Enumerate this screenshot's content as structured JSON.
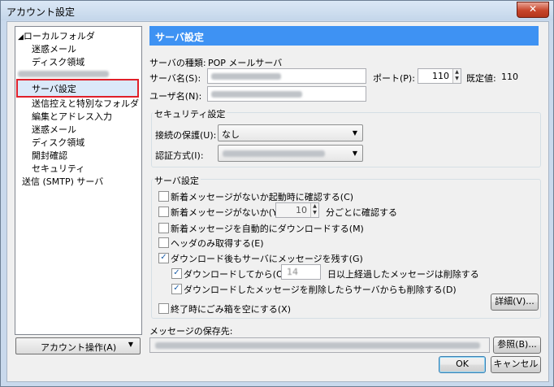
{
  "window": {
    "title": "アカウント設定",
    "close_label": "✕"
  },
  "tree": {
    "items": [
      {
        "label": "ローカルフォルダ",
        "twisty": "◢"
      },
      {
        "label": "迷惑メール"
      },
      {
        "label": "ディスク領域"
      },
      {
        "label": "サーバ設定"
      },
      {
        "label": "送信控えと特別なフォルダ"
      },
      {
        "label": "編集とアドレス入力"
      },
      {
        "label": "迷惑メール"
      },
      {
        "label": "ディスク領域"
      },
      {
        "label": "開封確認"
      },
      {
        "label": "セキュリティ"
      },
      {
        "label": "送信 (SMTP) サーバ"
      }
    ]
  },
  "account_actions": {
    "label": "アカウント操作(A)",
    "arrow": "▼"
  },
  "panel": {
    "header": "サーバ設定",
    "server_type_label": "サーバの種類:",
    "server_type_value": "POP メールサーバ",
    "server_name_label": "サーバ名(S):",
    "port_label": "ポート(P):",
    "port_value": "110",
    "default_label": "既定値:",
    "default_value": "110",
    "username_label": "ユーザ名(N):",
    "security": {
      "title": "セキュリティ設定",
      "connection_label": "接続の保護(U):",
      "connection_value": "なし",
      "auth_label": "認証方式(I):"
    },
    "server_settings": {
      "title": "サーバ設定",
      "opt_check_startup": "新着メッセージがないか起動時に確認する(C)",
      "opt_check_every": "新着メッセージがないか(Y)",
      "minutes_value": "10",
      "minutes_suffix": "分ごとに確認する",
      "opt_auto_download": "新着メッセージを自動的にダウンロードする(M)",
      "opt_headers_only": "ヘッダのみ取得する(E)",
      "opt_leave_on_server": "ダウンロード後もサーバにメッセージを残す(G)",
      "opt_delete_after": "ダウンロードしてから(O)",
      "days_value": "14",
      "days_suffix": "日以上経過したメッセージは削除する",
      "opt_delete_from_server": "ダウンロードしたメッセージを削除したらサーバからも削除する(D)",
      "advanced_button": "詳細(V)...",
      "opt_empty_trash": "終了時にごみ箱を空にする(X)"
    },
    "storage_label": "メッセージの保存先:",
    "browse_button": "参照(B)..."
  },
  "buttons": {
    "ok": "OK",
    "cancel": "キャンセル"
  },
  "checkmark": "✓"
}
